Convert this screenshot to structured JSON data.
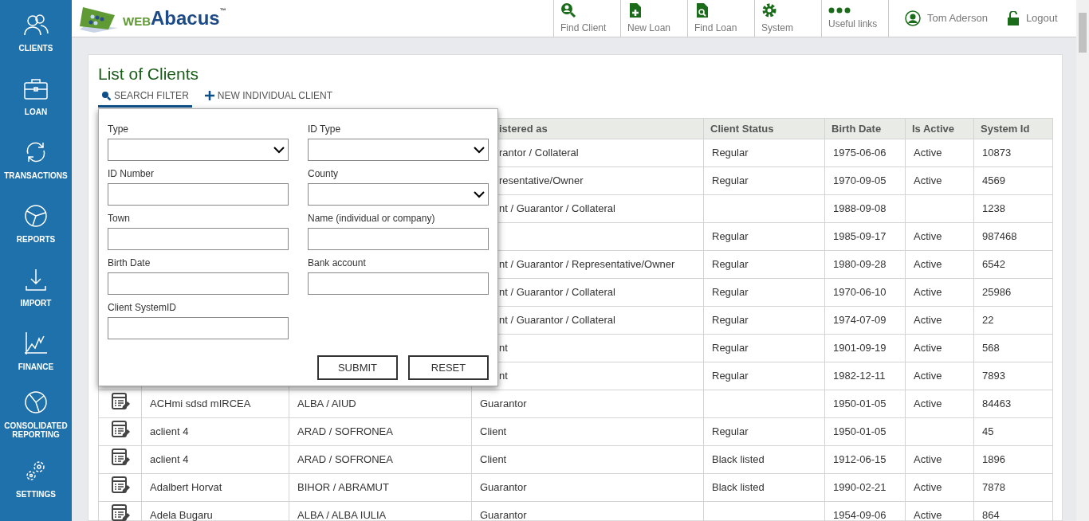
{
  "sidebar": {
    "items": [
      {
        "label": "CLIENTS",
        "kind": "clients"
      },
      {
        "label": "LOAN",
        "kind": "loan"
      },
      {
        "label": "TRANSACTIONS",
        "kind": "transactions"
      },
      {
        "label": "REPORTS",
        "kind": "reports"
      },
      {
        "label": "IMPORT",
        "kind": "import"
      },
      {
        "label": "FINANCE",
        "kind": "finance"
      },
      {
        "label": "CONSOLIDATED REPORTING",
        "kind": "consolidated"
      },
      {
        "label": "SETTINGS",
        "kind": "settings"
      }
    ]
  },
  "logo": {
    "prefix": "WEB",
    "name": "Abacus",
    "mark": "™"
  },
  "topnav": [
    {
      "label": "Find Client",
      "kind": "find-client"
    },
    {
      "label": "New Loan",
      "kind": "new-loan"
    },
    {
      "label": "Find Loan",
      "kind": "find-loan"
    },
    {
      "label": "System",
      "kind": "system"
    },
    {
      "label": "Useful links",
      "kind": "links"
    }
  ],
  "user": {
    "name": "Tom Aderson",
    "logout": "Logout"
  },
  "page_title": "List of Clients",
  "tabs": [
    {
      "label": "SEARCH FILTER",
      "kind": "search",
      "selected": true
    },
    {
      "label": "NEW INDIVIDUAL CLIENT",
      "kind": "add",
      "selected": false
    }
  ],
  "filter": {
    "fields": [
      {
        "label": "Type",
        "kind": "select"
      },
      {
        "label": "ID Type",
        "kind": "select"
      },
      {
        "label": "ID Number",
        "kind": "text"
      },
      {
        "label": "County",
        "kind": "select"
      },
      {
        "label": "Town",
        "kind": "text"
      },
      {
        "label": "Name (individual or company)",
        "kind": "text"
      },
      {
        "label": "Birth Date",
        "kind": "text"
      },
      {
        "label": "Bank account",
        "kind": "text"
      },
      {
        "label": "Client SystemID",
        "kind": "text"
      }
    ],
    "buttons": [
      "SUBMIT",
      "RESET"
    ]
  },
  "table": {
    "columns": [
      "istered as",
      "Client Status",
      "Birth Date",
      "Is Active",
      "System Id"
    ],
    "rows": [
      {
        "registered": "rantor / Collateral",
        "status": "Regular",
        "birth": "1975-06-06",
        "active": "Active",
        "id": "10873"
      },
      {
        "registered": "resentative/Owner",
        "status": "Regular",
        "birth": "1970-09-05",
        "active": "Active",
        "id": "4569"
      },
      {
        "registered": "nt / Guarantor / Collateral",
        "birth": "1988-09-08",
        "id": "1238"
      },
      {
        "status": "Regular",
        "birth": "1985-09-17",
        "active": "Active",
        "id": "987468"
      },
      {
        "registered": "nt / Guarantor / Representative/Owner",
        "status": "Regular",
        "birth": "1980-09-28",
        "active": "Active",
        "id": "6542"
      },
      {
        "registered": "nt / Guarantor / Collateral",
        "status": "Regular",
        "birth": "1970-06-10",
        "active": "Active",
        "id": "25986"
      },
      {
        "registered": "nt / Guarantor / Collateral",
        "status": "Regular",
        "birth": "1974-07-09",
        "active": "Active",
        "id": "22"
      },
      {
        "registered": "nt",
        "status": "Regular",
        "birth": "1901-09-19",
        "active": "Active",
        "id": "568"
      },
      {
        "registered": "nt",
        "status": "Regular",
        "birth": "1982-12-11",
        "active": "Active",
        "id": "7893"
      },
      {
        "name": "ACHmi sdsd mIRCEA",
        "place": "ALBA / AIUD",
        "registered": "Guarantor",
        "birth": "1950-01-05",
        "active": "Active",
        "id": "84463"
      },
      {
        "name": "aclient 4",
        "place": "ARAD / SOFRONEA",
        "registered": "Client",
        "status": "Regular",
        "birth": "1950-01-05",
        "id": "45"
      },
      {
        "name": "aclient 4",
        "place": "ARAD / SOFRONEA",
        "registered": "Client",
        "status": "Black listed",
        "birth": "1912-06-15",
        "active": "Active",
        "id": "1896"
      },
      {
        "name": " Adalbert Horvat",
        "place": "BIHOR / ABRAMUT",
        "registered": "Guarantor",
        "status": "Black listed",
        "birth": "1990-02-21",
        "active": "Active",
        "id": "7878"
      },
      {
        "name": "Adela Bugaru",
        "place": "ALBA / ALBA IULIA",
        "registered": "Guarantor",
        "birth": "1954-09-06",
        "active": "Active",
        "id": "864"
      }
    ]
  }
}
